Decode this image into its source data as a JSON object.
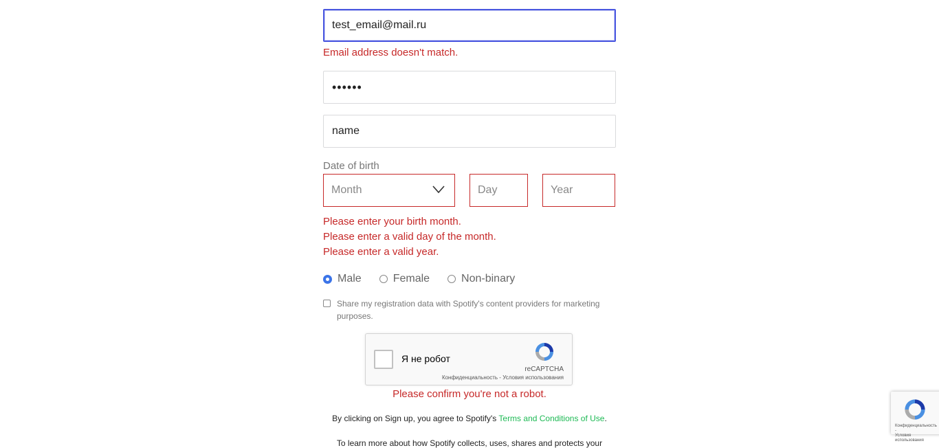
{
  "form": {
    "email_confirm_value": "test_email@mail.ru",
    "email_error": "Email address doesn't match.",
    "password_value": "••••••",
    "name_value": "name",
    "dob_label": "Date of birth",
    "month_placeholder": "Month",
    "day_placeholder": "Day",
    "year_placeholder": "Year",
    "month_error": "Please enter your birth month.",
    "day_error": "Please enter a valid day of the month.",
    "year_error": "Please enter a valid year.",
    "gender_options": [
      "Male",
      "Female",
      "Non-binary"
    ],
    "selected_gender": "Male",
    "share_label": "Share my registration data with Spotify's content providers for marketing purposes."
  },
  "captcha": {
    "label": "Я не робот",
    "brand": "reCAPTCHA",
    "links": "Конфиденциальность - Условия использования",
    "error": "Please confirm you're not a robot."
  },
  "footer": {
    "terms_prefix": "By clicking on Sign up, you agree to Spotify's",
    "terms_link": "Terms and Conditions of Use",
    "terms_suffix": ".",
    "learn_more": "To learn more about how Spotify collects, uses, shares and protects your"
  },
  "badge": {
    "links_line1": "Конфиденциальность -",
    "links_line2": "Условия использования"
  },
  "colors": {
    "error": "#c62828",
    "focus": "#4a57e0",
    "link": "#1db954",
    "radio_selected": "#3b74e8"
  }
}
